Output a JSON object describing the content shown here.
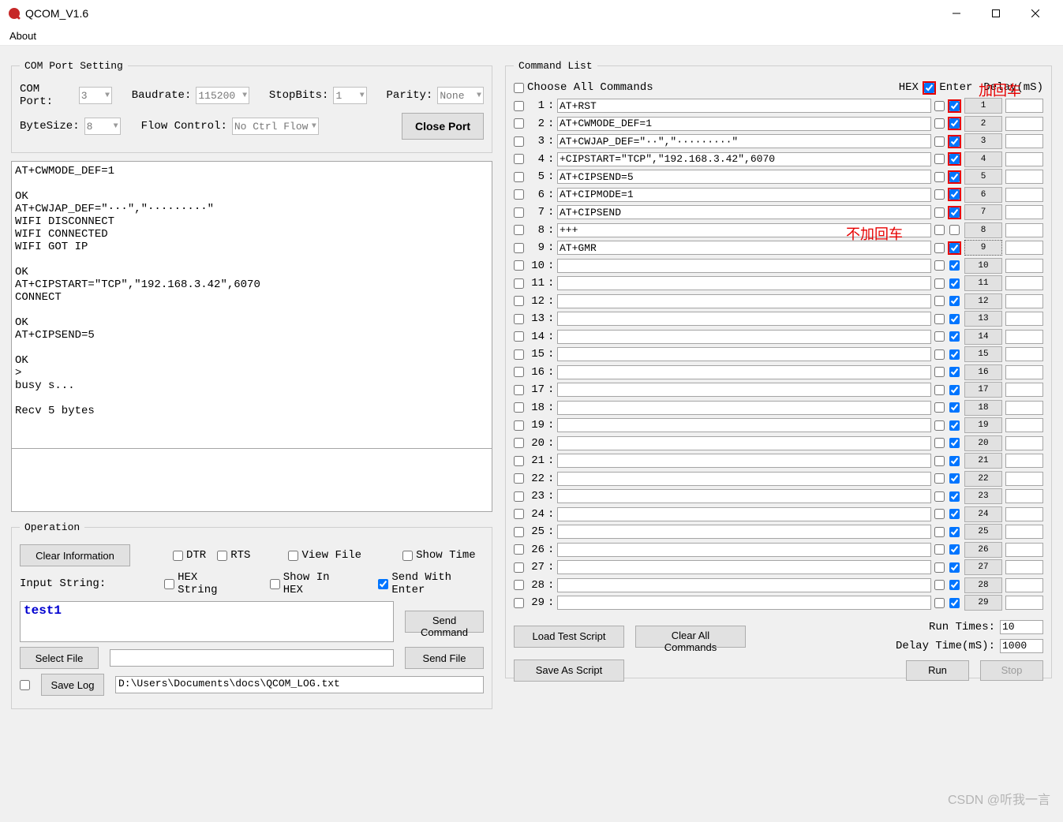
{
  "window": {
    "title": "QCOM_V1.6"
  },
  "menu": {
    "about": "About"
  },
  "com": {
    "legend": "COM Port Setting",
    "comport_label": "COM Port:",
    "comport_val": "3",
    "baud_label": "Baudrate:",
    "baud_val": "115200",
    "stopbits_label": "StopBits:",
    "stopbits_val": "1",
    "parity_label": "Parity:",
    "parity_val": "None",
    "bytesize_label": "ByteSize:",
    "bytesize_val": "8",
    "flow_label": "Flow Control:",
    "flow_val": "No Ctrl Flow",
    "close_btn": "Close Port"
  },
  "terminal_text": "AT+CWMODE_DEF=1\n\nOK\nAT+CWJAP_DEF=\"···\",\"·········\"\nWIFI DISCONNECT\nWIFI CONNECTED\nWIFI GOT IP\n\nOK\nAT+CIPSTART=\"TCP\",\"192.168.3.42\",6070\nCONNECT\n\nOK\nAT+CIPSEND=5\n\nOK\n>\nbusy s...\n\nRecv 5 bytes",
  "operation": {
    "legend": "Operation",
    "clear_btn": "Clear Information",
    "dtr": "DTR",
    "rts": "RTS",
    "viewfile": "View File",
    "showtime": "Show Time",
    "hexstr": "HEX String",
    "showinhex": "Show In HEX",
    "sendwithenter": "Send With Enter",
    "input_label": "Input String:",
    "input_value": "test1",
    "send_cmd": "Send Command",
    "select_file": "Select File",
    "send_file": "Send File",
    "save_log": "Save Log",
    "log_path": "D:\\Users\\Documents\\docs\\QCOM_LOG.txt"
  },
  "cmdlist": {
    "legend": "Command List",
    "choose_all": "Choose All Commands",
    "hex_label": "HEX",
    "enter_label": "Enter",
    "delay_label": "Delay(mS)",
    "load_btn": "Load Test Script",
    "clear_btn": "Clear All Commands",
    "save_btn": "Save As Script",
    "runtimes_label": "Run Times:",
    "runtimes_val": "10",
    "delaytime_label": "Delay Time(mS):",
    "delaytime_val": "1000",
    "run_btn": "Run",
    "stop_btn": "Stop",
    "annot1": "加回车",
    "annot2": "不加回车",
    "rows": [
      {
        "n": 1,
        "cmd": "AT+RST",
        "hex": false,
        "enter": true
      },
      {
        "n": 2,
        "cmd": "AT+CWMODE_DEF=1",
        "hex": false,
        "enter": true
      },
      {
        "n": 3,
        "cmd": "AT+CWJAP_DEF=\"··\",\"·········\"",
        "hex": false,
        "enter": true
      },
      {
        "n": 4,
        "cmd": "+CIPSTART=\"TCP\",\"192.168.3.42\",6070",
        "hex": false,
        "enter": true
      },
      {
        "n": 5,
        "cmd": "AT+CIPSEND=5",
        "hex": false,
        "enter": true
      },
      {
        "n": 6,
        "cmd": "AT+CIPMODE=1",
        "hex": false,
        "enter": true
      },
      {
        "n": 7,
        "cmd": "AT+CIPSEND",
        "hex": false,
        "enter": true
      },
      {
        "n": 8,
        "cmd": "+++",
        "hex": false,
        "enter": false
      },
      {
        "n": 9,
        "cmd": "AT+GMR",
        "hex": false,
        "enter": true
      },
      {
        "n": 10,
        "cmd": "",
        "hex": false,
        "enter": true
      },
      {
        "n": 11,
        "cmd": "",
        "hex": false,
        "enter": true
      },
      {
        "n": 12,
        "cmd": "",
        "hex": false,
        "enter": true
      },
      {
        "n": 13,
        "cmd": "",
        "hex": false,
        "enter": true
      },
      {
        "n": 14,
        "cmd": "",
        "hex": false,
        "enter": true
      },
      {
        "n": 15,
        "cmd": "",
        "hex": false,
        "enter": true
      },
      {
        "n": 16,
        "cmd": "",
        "hex": false,
        "enter": true
      },
      {
        "n": 17,
        "cmd": "",
        "hex": false,
        "enter": true
      },
      {
        "n": 18,
        "cmd": "",
        "hex": false,
        "enter": true
      },
      {
        "n": 19,
        "cmd": "",
        "hex": false,
        "enter": true
      },
      {
        "n": 20,
        "cmd": "",
        "hex": false,
        "enter": true
      },
      {
        "n": 21,
        "cmd": "",
        "hex": false,
        "enter": true
      },
      {
        "n": 22,
        "cmd": "",
        "hex": false,
        "enter": true
      },
      {
        "n": 23,
        "cmd": "",
        "hex": false,
        "enter": true
      },
      {
        "n": 24,
        "cmd": "",
        "hex": false,
        "enter": true
      },
      {
        "n": 25,
        "cmd": "",
        "hex": false,
        "enter": true
      },
      {
        "n": 26,
        "cmd": "",
        "hex": false,
        "enter": true
      },
      {
        "n": 27,
        "cmd": "",
        "hex": false,
        "enter": true
      },
      {
        "n": 28,
        "cmd": "",
        "hex": false,
        "enter": true
      },
      {
        "n": 29,
        "cmd": "",
        "hex": false,
        "enter": true
      }
    ]
  },
  "watermark": "CSDN @听我一言"
}
